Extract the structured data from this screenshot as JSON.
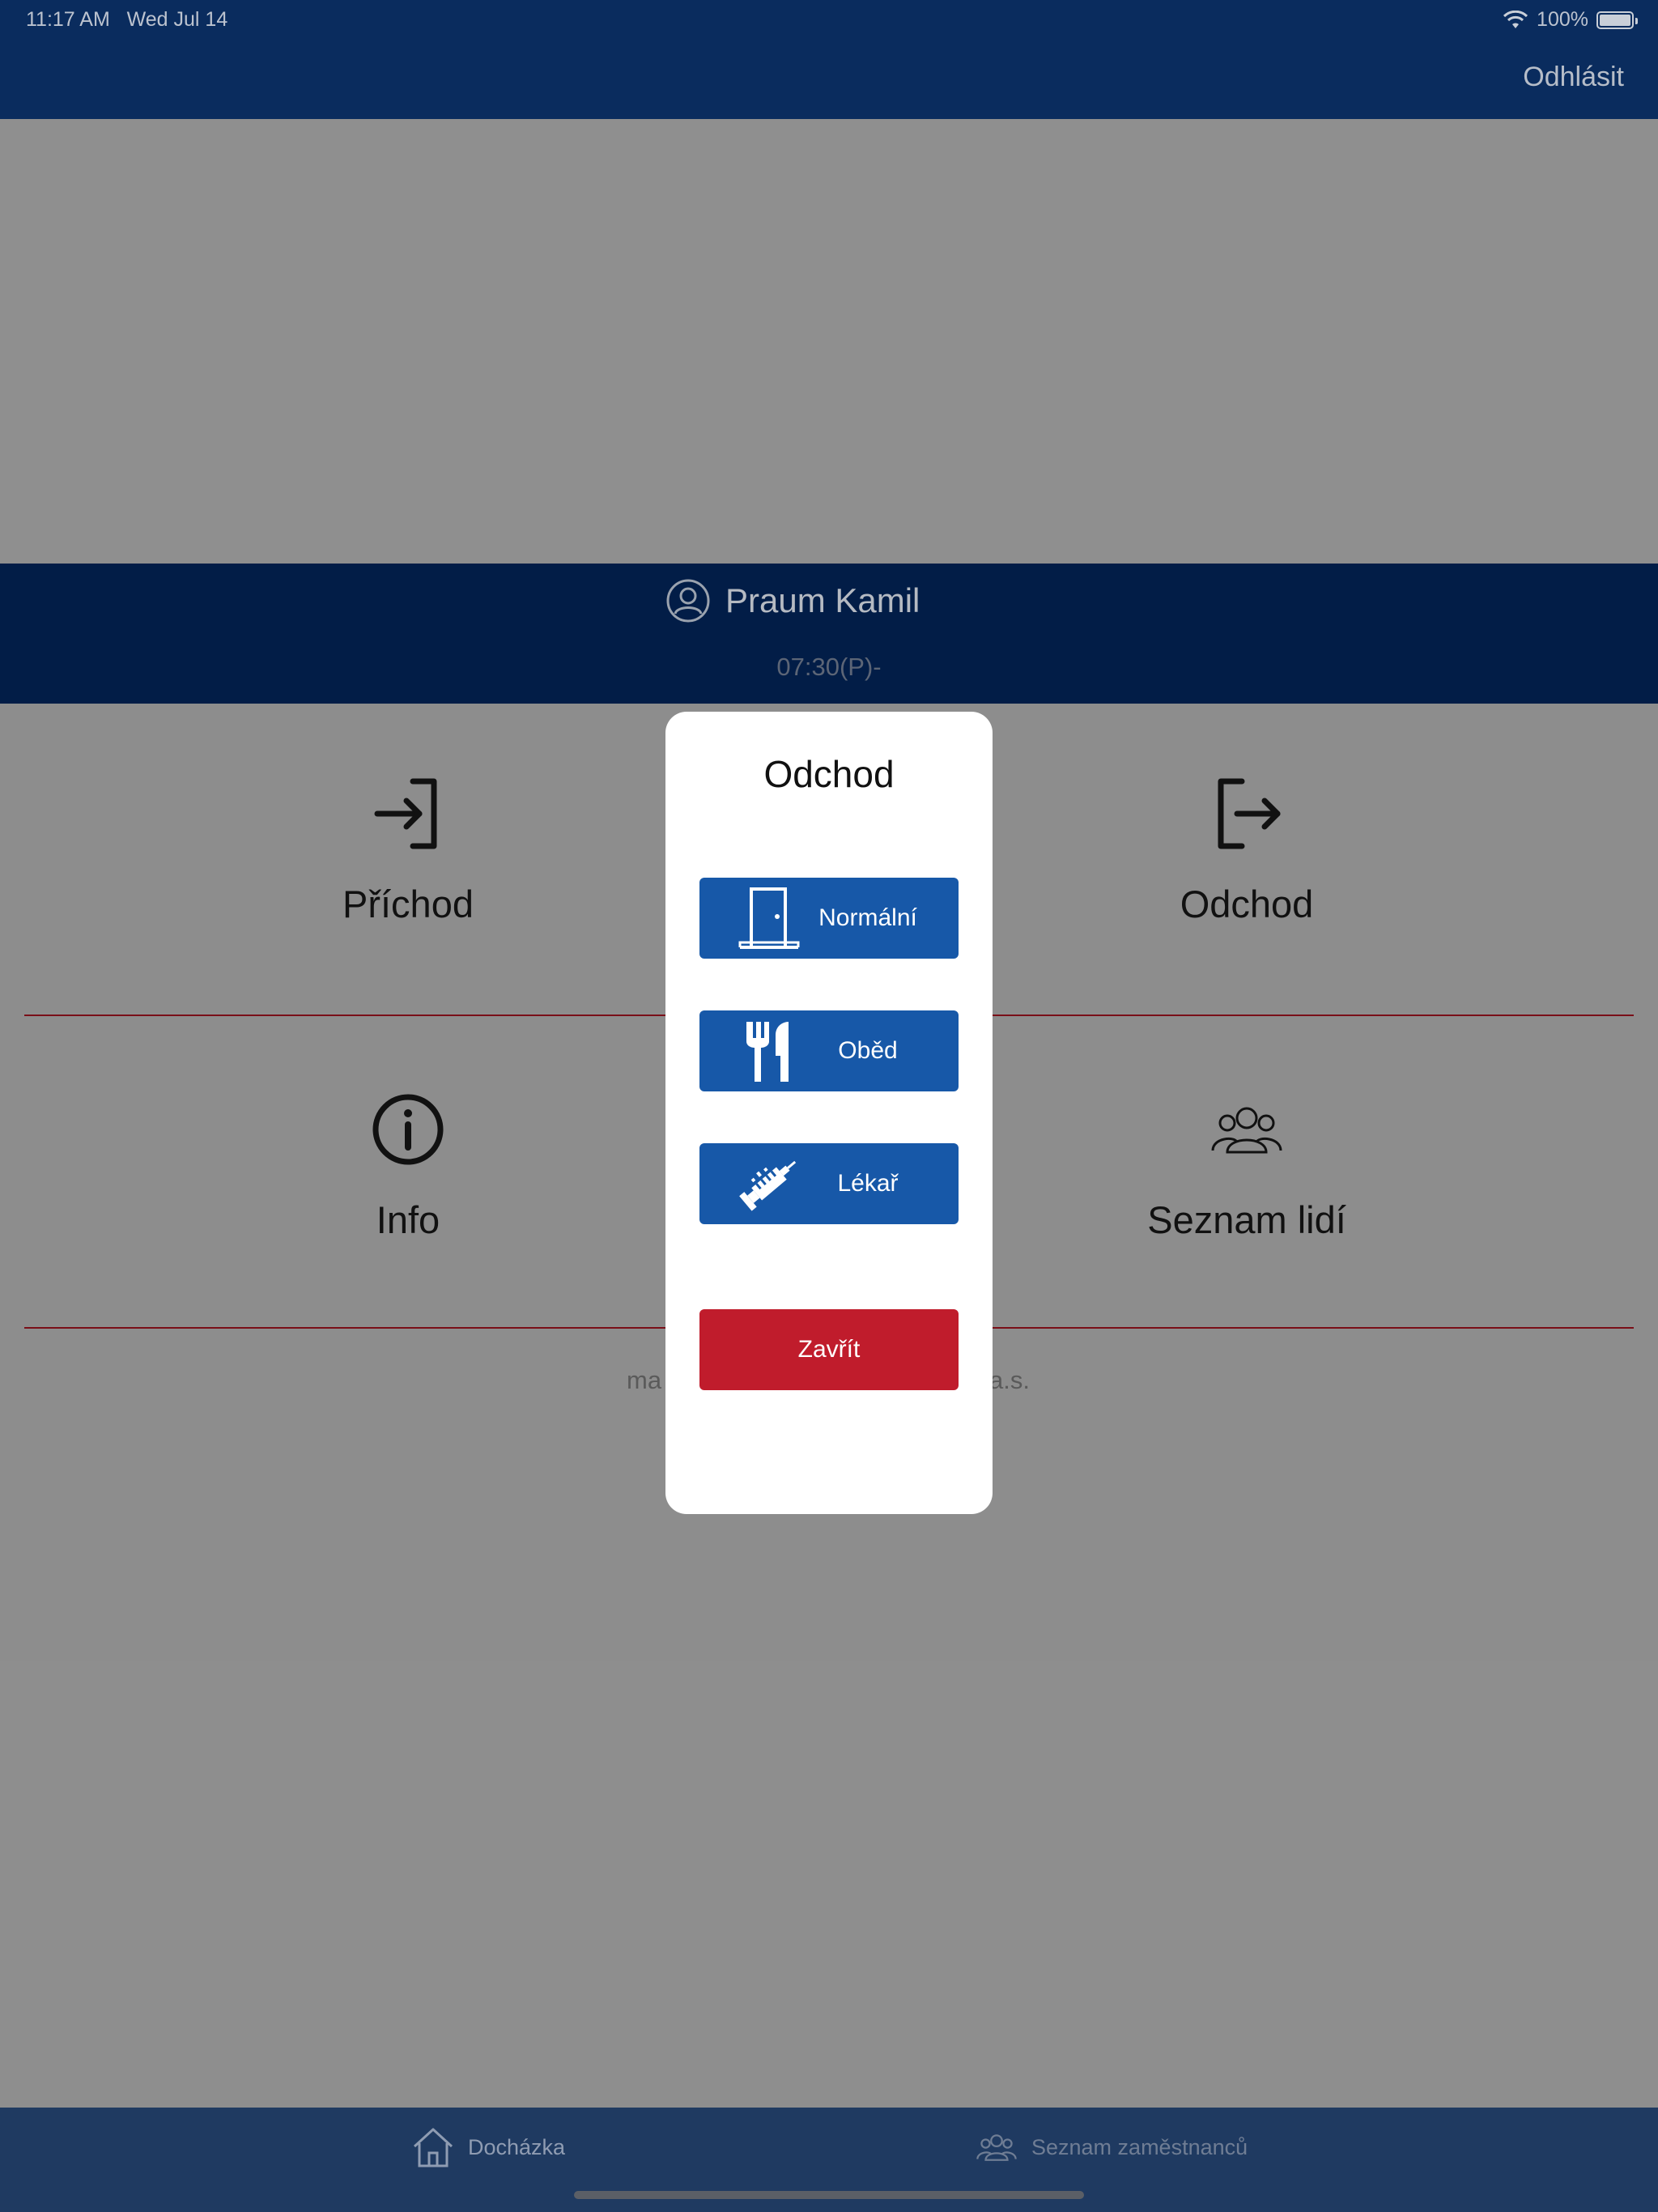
{
  "status_bar": {
    "time": "11:17 AM",
    "date": "Wed Jul 14",
    "battery": "100%"
  },
  "nav": {
    "logout_label": "Odhlásit"
  },
  "user": {
    "name": "Praum Kamil",
    "time": "07:30(P)-"
  },
  "tiles": {
    "arrival": "Příchod",
    "departure": "Odchod",
    "info": "Info",
    "people": "Seznam lidí"
  },
  "footer": {
    "left": "ma",
    "right": "a.s."
  },
  "modal": {
    "title": "Odchod",
    "normal": "Normální",
    "lunch": "Oběd",
    "doctor": "Lékař",
    "close": "Zavřít"
  },
  "tabbar": {
    "attendance": "Docházka",
    "employees": "Seznam zaměstnanců"
  },
  "colors": {
    "header": "#0a2c5e",
    "banner": "#021d47",
    "modal_button": "#1758a8",
    "close_button": "#c01c2c",
    "divider": "#7a0f18"
  }
}
